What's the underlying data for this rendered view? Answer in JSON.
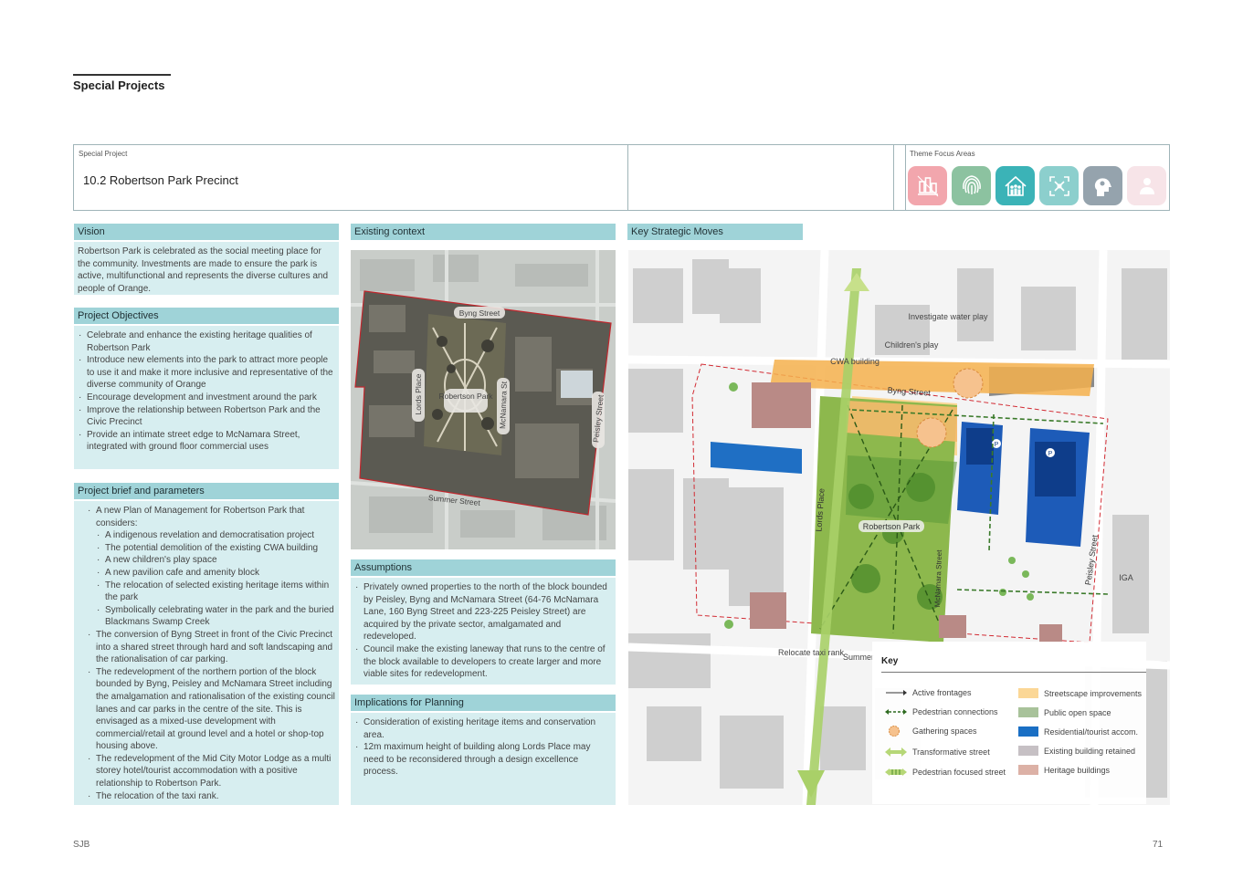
{
  "section_title": "Special Projects",
  "project": {
    "label": "Special Project",
    "title": "10.2  Robertson Park Precinct",
    "theme_label": "Theme Focus Areas",
    "themes": [
      {
        "icon": "city-icon",
        "color": "#f2a6ad"
      },
      {
        "icon": "fingerprint-icon",
        "color": "#8cc2a0"
      },
      {
        "icon": "community-icon",
        "color": "#3bb3b7"
      },
      {
        "icon": "network-icon",
        "color": "#8ccfcd"
      },
      {
        "icon": "mind-icon",
        "color": "#95a3ad"
      },
      {
        "icon": "people-icon",
        "color": "#f7e4e8"
      }
    ]
  },
  "vision": {
    "heading": "Vision",
    "text": "Robertson Park is celebrated as the social meeting place for the community. Investments are made to ensure the park is active, multifunctional and represents the diverse cultures and people of Orange."
  },
  "objectives": {
    "heading": "Project Objectives",
    "items": [
      "Celebrate and enhance the existing heritage qualities of Robertson Park",
      "Introduce new elements into the park to attract more people to use it and make it more inclusive and representative of the diverse community of Orange",
      "Encourage development and investment around the park",
      "Improve the relationship between Robertson Park and the Civic Precinct",
      "Provide an intimate street edge to McNamara Street, integrated with ground floor commercial uses"
    ]
  },
  "brief": {
    "heading": "Project brief and parameters",
    "item1": "A new Plan of Management for Robertson Park that considers:",
    "sub": [
      "A indigenous revelation and democratisation project",
      "The potential demolition of the existing CWA building",
      "A new children's play space",
      "A new pavilion cafe and amenity block",
      "The relocation of selected existing heritage items within the park",
      "Symbolically celebrating water in the park and the buried Blackmans Swamp Creek"
    ],
    "items": [
      "The conversion of Byng Street in front of the Civic Precinct into a shared street through hard and soft landscaping and the rationalisation of car parking.",
      "The redevelopment of the northern portion of the block bounded by Byng, Peisley and McNamara Street including the amalgamation and rationalisation of the existing council lanes and car parks in the centre of the site. This is envisaged as a mixed-use development with commercial/retail at ground level and a hotel or shop-top housing above.",
      "The redevelopment of the Mid City Motor Lodge as a multi storey hotel/tourist accommodation with a positive relationship to Robertson Park.",
      "The relocation of the taxi rank."
    ]
  },
  "context": {
    "heading": "Existing context",
    "labels": {
      "byng": "Byng Street",
      "lords": "Lords Place",
      "park": "Robertson Park",
      "mcnamara": "McNamara St",
      "peisley": "Peisley Street",
      "summer": "Summer Street"
    }
  },
  "assumptions": {
    "heading": "Assumptions",
    "items": [
      "Privately owned properties to the north of the block bounded by Peisley, Byng and McNamara Street (64-76 McNamara Lane, 160 Byng Street and 223-225 Peisley Street) are acquired by the private sector, amalgamated and redeveloped.",
      "Council make the existing laneway that runs to the centre of the block available to developers to create larger and more viable sites for redevelopment."
    ]
  },
  "implications": {
    "heading": "Implications for Planning",
    "items": [
      "Consideration of existing heritage items and conservation area.",
      "12m maximum height of building along Lords Place may need to be reconsidered through a design excellence process."
    ]
  },
  "moves": {
    "heading": "Key Strategic Moves",
    "labels": {
      "investigate": "Investigate water play",
      "childrens": "Children's play",
      "cwa": "CWA building",
      "byng": "Byng Street",
      "lords": "Lords Place",
      "park": "Robertson Park",
      "mcnamara": "McNamara Street",
      "peisley": "Peisley Street",
      "iga": "IGA",
      "relocate": "Relocate taxi rank",
      "summer": "Summer",
      "p": "P"
    }
  },
  "key": {
    "title": "Key",
    "left": [
      "Active frontages",
      "Pedestrian connections",
      "Gathering spaces",
      "Transformative street",
      "Pedestrian focused street"
    ],
    "right": [
      {
        "label": "Streetscape improvements",
        "color": "#fbd796"
      },
      {
        "label": "Public open space",
        "color": "#a8c29a"
      },
      {
        "label": "Residential/tourist accom.",
        "color": "#1a6fc4"
      },
      {
        "label": "Existing building retained",
        "color": "#c6c0c4"
      },
      {
        "label": "Heritage buildings",
        "color": "#dcb1a6"
      }
    ]
  },
  "footer": {
    "left": "SJB",
    "page": "71"
  }
}
